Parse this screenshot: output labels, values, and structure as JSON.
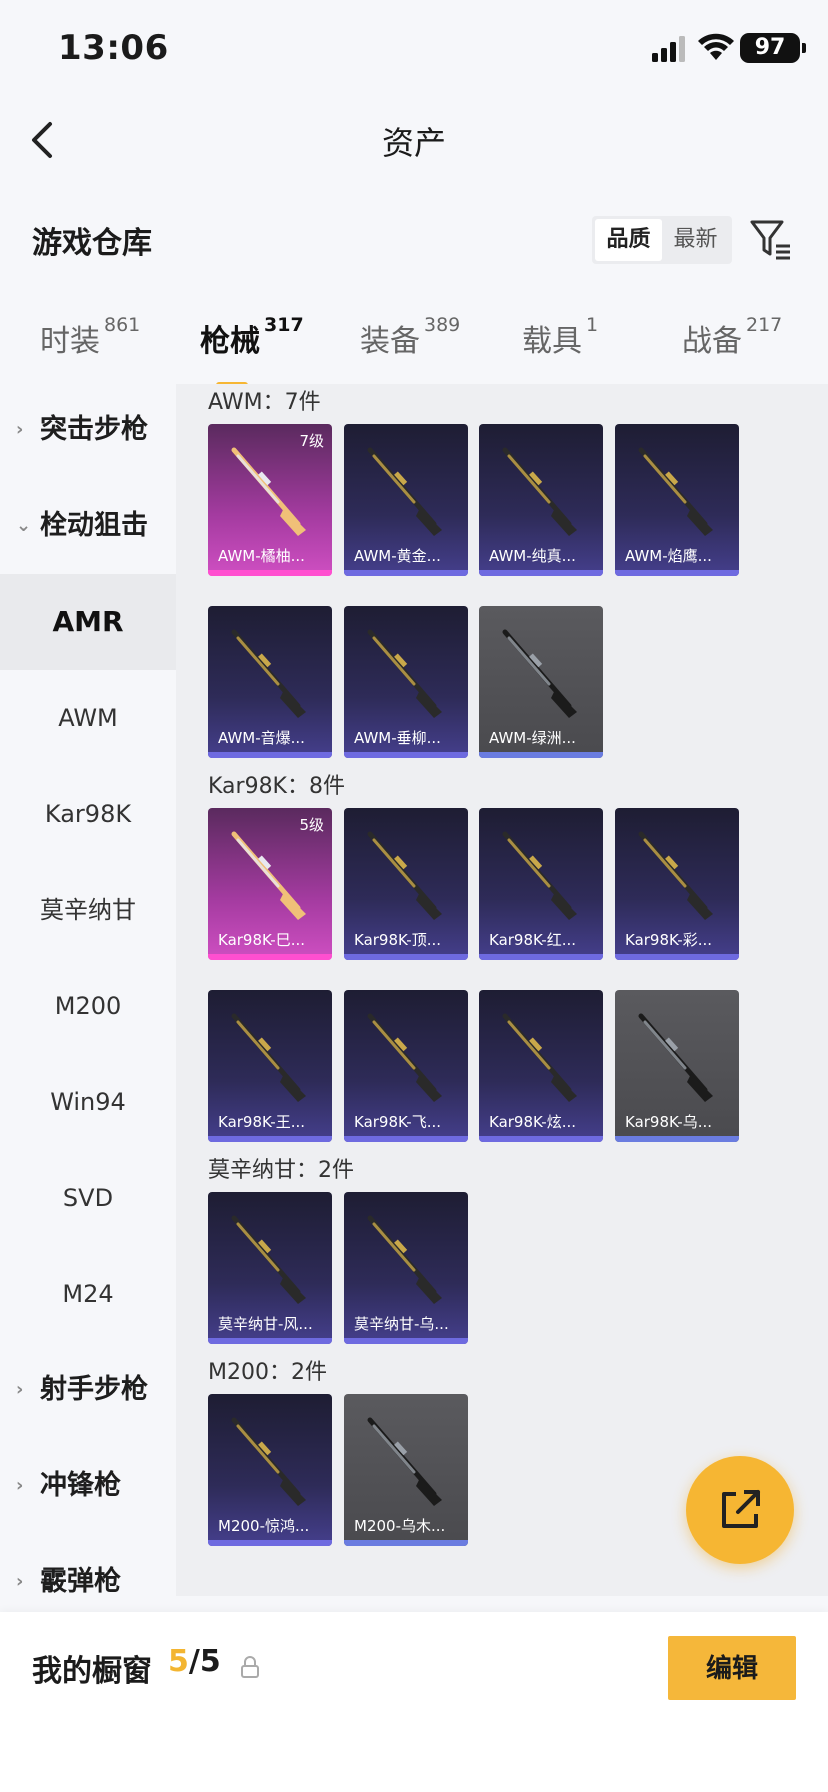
{
  "status_bar": {
    "time": "13:06",
    "battery": "97"
  },
  "nav": {
    "title": "资产"
  },
  "section": {
    "title": "游戏仓库",
    "sort": [
      "品质",
      "最新"
    ],
    "active_sort": "品质"
  },
  "category_tabs": [
    {
      "label": "时装",
      "count": "861"
    },
    {
      "label": "枪械",
      "count": "317",
      "active": true
    },
    {
      "label": "装备",
      "count": "389"
    },
    {
      "label": "载具",
      "count": "1"
    },
    {
      "label": "战备",
      "count": "217"
    }
  ],
  "sidebar": [
    {
      "label": "突击步枪",
      "type": "group",
      "chevron": "›"
    },
    {
      "label": "栓动狙击",
      "type": "group",
      "chevron": "⌄"
    },
    {
      "label": "AMR",
      "type": "item",
      "active": true
    },
    {
      "label": "AWM",
      "type": "item"
    },
    {
      "label": "Kar98K",
      "type": "item"
    },
    {
      "label": "莫辛纳甘",
      "type": "item"
    },
    {
      "label": "M200",
      "type": "item"
    },
    {
      "label": "Win94",
      "type": "item"
    },
    {
      "label": "SVD",
      "type": "item"
    },
    {
      "label": "M24",
      "type": "item"
    },
    {
      "label": "射手步枪",
      "type": "group",
      "chevron": "›"
    },
    {
      "label": "冲锋枪",
      "type": "group",
      "chevron": "›"
    },
    {
      "label": "霰弹枪",
      "type": "group",
      "chevron": "›"
    }
  ],
  "groups": [
    {
      "title": "AWM：7件",
      "items": [
        {
          "label": "AWM-橘柚...",
          "rarity": "pink",
          "level": "7级"
        },
        {
          "label": "AWM-黄金...",
          "rarity": "purple"
        },
        {
          "label": "AWM-纯真...",
          "rarity": "purple"
        },
        {
          "label": "AWM-焰鹰...",
          "rarity": "purple"
        },
        {
          "label": "AWM-音爆...",
          "rarity": "purple"
        },
        {
          "label": "AWM-垂柳...",
          "rarity": "purple"
        },
        {
          "label": "AWM-绿洲...",
          "rarity": "gray"
        }
      ]
    },
    {
      "title": "Kar98K：8件",
      "items": [
        {
          "label": "Kar98K-巳...",
          "rarity": "pink",
          "level": "5级"
        },
        {
          "label": "Kar98K-顶...",
          "rarity": "purple"
        },
        {
          "label": "Kar98K-红...",
          "rarity": "purple"
        },
        {
          "label": "Kar98K-彩...",
          "rarity": "purple"
        },
        {
          "label": "Kar98K-王...",
          "rarity": "purple"
        },
        {
          "label": "Kar98K-飞...",
          "rarity": "purple"
        },
        {
          "label": "Kar98K-炫...",
          "rarity": "purple"
        },
        {
          "label": "Kar98K-乌...",
          "rarity": "gray"
        }
      ]
    },
    {
      "title": "莫辛纳甘：2件",
      "items": [
        {
          "label": "莫辛纳甘-风...",
          "rarity": "purple"
        },
        {
          "label": "莫辛纳甘-乌...",
          "rarity": "purple"
        }
      ]
    },
    {
      "title": "M200：2件",
      "items": [
        {
          "label": "M200-惊鸿...",
          "rarity": "purple"
        },
        {
          "label": "M200-乌木...",
          "rarity": "gray"
        }
      ]
    }
  ],
  "showcase": {
    "label": "我的橱窗",
    "current": "5",
    "total": "/5",
    "edit_label": "编辑"
  },
  "colors": {
    "accent": "#f6b633",
    "purple_rarity": "#453f8d",
    "pink_rarity": "#cf4fc2"
  }
}
